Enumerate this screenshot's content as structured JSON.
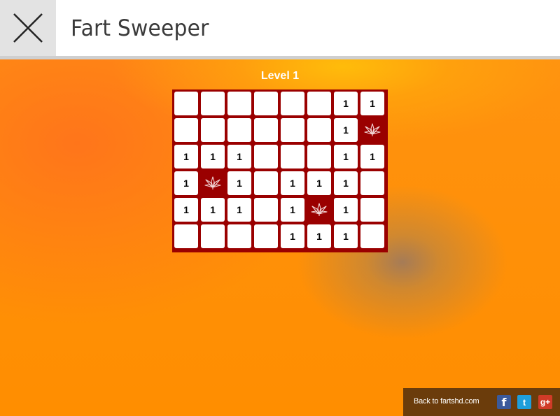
{
  "header": {
    "title": "Fart Sweeper",
    "close_icon": "close-x-icon"
  },
  "game": {
    "level_label": "Level 1",
    "columns": 8,
    "rows": 6,
    "board": [
      [
        "",
        "",
        "",
        "",
        "",
        "",
        "1",
        "1"
      ],
      [
        "",
        "",
        "",
        "",
        "",
        "",
        "1",
        "mine"
      ],
      [
        "1",
        "1",
        "1",
        "",
        "",
        "",
        "1",
        "1"
      ],
      [
        "1",
        "mine",
        "1",
        "",
        "1",
        "1",
        "1",
        ""
      ],
      [
        "1",
        "1",
        "1",
        "",
        "1",
        "mine",
        "1",
        ""
      ],
      [
        "",
        "",
        "",
        "",
        "1",
        "1",
        "1",
        ""
      ]
    ],
    "mine_icon": "leaf-mine-icon",
    "colors": {
      "board": "#9a0000",
      "cell": "#ffffff"
    }
  },
  "footer": {
    "back_link": "Back to fartshd.com",
    "social": [
      {
        "name": "facebook-icon",
        "glyph": "f"
      },
      {
        "name": "twitter-icon",
        "glyph": "t"
      },
      {
        "name": "google-plus-icon",
        "glyph": "g+"
      }
    ]
  }
}
